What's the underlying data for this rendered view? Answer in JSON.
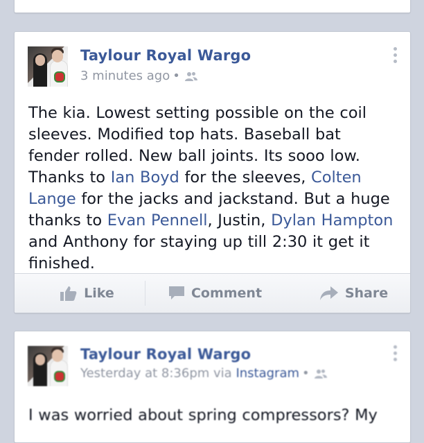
{
  "posts": [
    {
      "author": "Taylour Royal Wargo",
      "timestamp": "3 minutes ago",
      "separator": "•",
      "audience_icon": "friends-icon",
      "body": {
        "s1": "The kia. Lowest setting possible on the coil sleeves. Modified top hats. Baseball bat fender rolled. New ball joints. Its sooo low. Thanks to ",
        "m1": "Ian Boyd",
        "s2": " for the sleeves, ",
        "m2": "Colten Lange",
        "s3": " for the jacks and jackstand. But a huge thanks to ",
        "m3": "Evan Pennell",
        "s4": ", Justin, ",
        "m4": "Dylan Hampton",
        "s5": " and Anthony for staying up till 2:30 it get it finished."
      },
      "actions": {
        "like": "Like",
        "comment": "Comment",
        "share": "Share"
      }
    },
    {
      "author": "Taylour Royal Wargo",
      "timestamp": "Yesterday at 8:36pm",
      "via_prefix": "via",
      "via_app": "Instagram",
      "separator": "•",
      "audience_icon": "friends-icon",
      "body_preview": "I was worried about spring compressors? My"
    }
  ],
  "colors": {
    "background": "#cfd4df",
    "link": "#3b5998",
    "text": "#141823",
    "meta": "#9197a3",
    "action": "#7f8794"
  }
}
